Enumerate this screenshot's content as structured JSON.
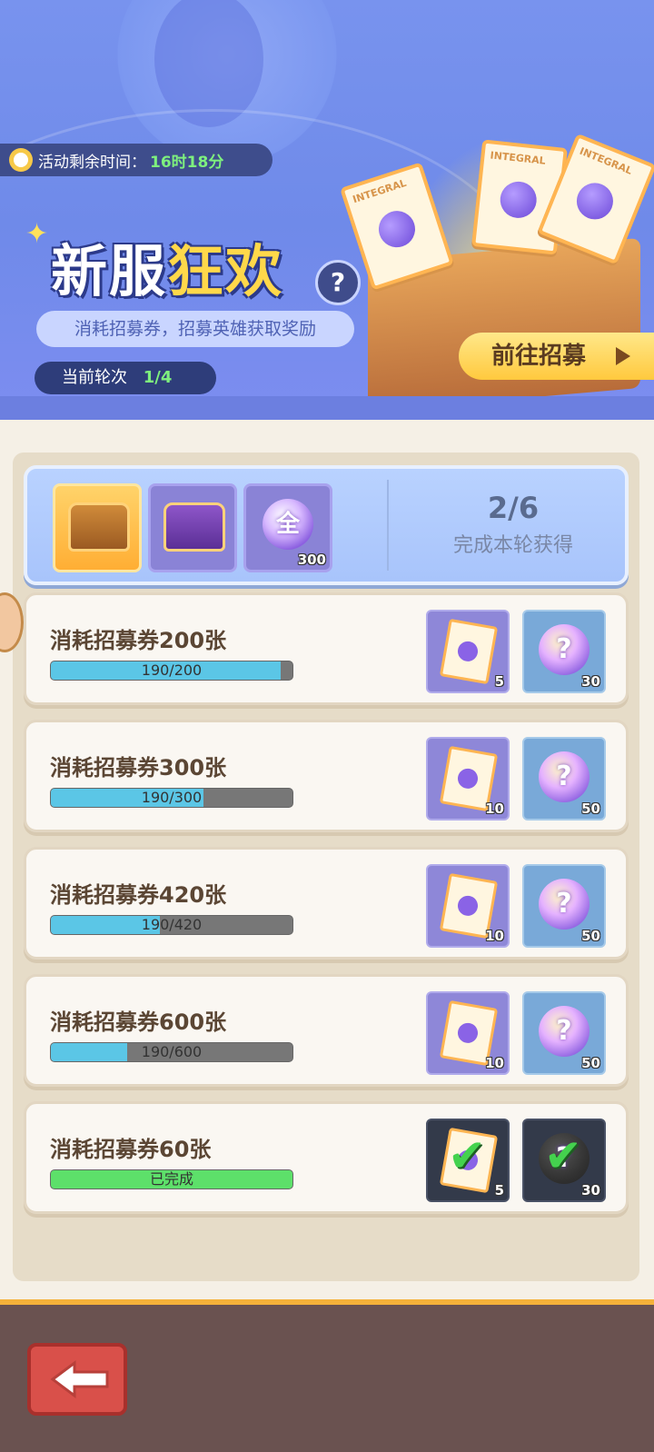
{
  "header": {
    "timer_label": "活动剩余时间：",
    "timer_value": "16时18分",
    "title_part1": "新服",
    "title_part2": "狂欢",
    "subtitle": "消耗招募券，招募英雄获取奖励",
    "round_label": "当前轮次",
    "round_value": "1/4",
    "go_button": "前往招募",
    "ticket_text": "INTEGRAL"
  },
  "round_rewards": {
    "items": [
      {
        "icon": "gold-chest-icon"
      },
      {
        "icon": "purple-chest-icon"
      },
      {
        "icon": "orb-icon",
        "glyph": "全",
        "count": "300"
      }
    ],
    "progress": "2/6",
    "caption": "完成本轮获得"
  },
  "tasks": [
    {
      "name": "消耗招募券200张",
      "progress_text": "190/200",
      "progress": 0.95,
      "ticket_count": "5",
      "orb_count": "30",
      "done": false
    },
    {
      "name": "消耗招募券300张",
      "progress_text": "190/300",
      "progress": 0.633,
      "ticket_count": "10",
      "orb_count": "50",
      "done": false
    },
    {
      "name": "消耗招募券420张",
      "progress_text": "190/420",
      "progress": 0.452,
      "ticket_count": "10",
      "orb_count": "50",
      "done": false
    },
    {
      "name": "消耗招募券600张",
      "progress_text": "190/600",
      "progress": 0.317,
      "ticket_count": "10",
      "orb_count": "50",
      "done": false
    },
    {
      "name": "消耗招募券60张",
      "progress_text": "已完成",
      "progress": 1.0,
      "ticket_count": "5",
      "orb_count": "30",
      "done": true
    }
  ],
  "orb_glyph": "?",
  "colors": {
    "progress_fill": "#5bc6e6",
    "done_fill": "#5de06a",
    "accent_gold": "#ffc93e"
  }
}
